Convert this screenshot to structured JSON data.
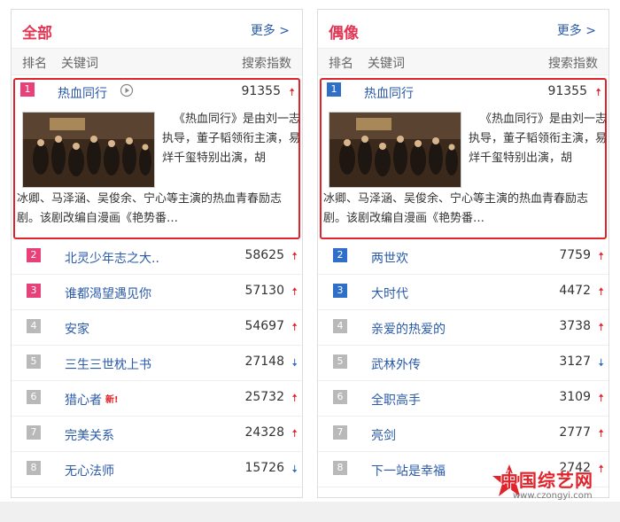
{
  "left_panel": {
    "title": "全部",
    "more": "更多 >",
    "columns": {
      "rank": "排名",
      "keyword": "关键词",
      "index": "搜索指数"
    },
    "featured": {
      "rank": "1",
      "keyword": "热血同行",
      "index": "91355",
      "trend": "up",
      "desc_right": "《热血同行》是由刘一志执导，董子韬领衔主演，易烊千玺特别出演，胡",
      "desc_bottom": "冰卿、马泽涵、吴俊余、宁心等主演的热血青春励志剧。该剧改编自漫画《艳势番…"
    },
    "rows": [
      {
        "rank": "2",
        "keyword": "北灵少年志之大..",
        "index": "58625",
        "trend": "up",
        "badge": "hot"
      },
      {
        "rank": "3",
        "keyword": "谁都渴望遇见你",
        "index": "57130",
        "trend": "up",
        "badge": "hot"
      },
      {
        "rank": "4",
        "keyword": "安家",
        "index": "54697",
        "trend": "up",
        "badge": "gray"
      },
      {
        "rank": "5",
        "keyword": "三生三世枕上书",
        "index": "27148",
        "trend": "down",
        "badge": "gray"
      },
      {
        "rank": "6",
        "keyword": "猎心者",
        "index": "25732",
        "trend": "up",
        "badge": "gray",
        "tag": "新!"
      },
      {
        "rank": "7",
        "keyword": "完美关系",
        "index": "24328",
        "trend": "up",
        "badge": "gray"
      },
      {
        "rank": "8",
        "keyword": "无心法师",
        "index": "15726",
        "trend": "down",
        "badge": "gray"
      }
    ]
  },
  "right_panel": {
    "title": "偶像",
    "more": "更多 >",
    "columns": {
      "rank": "排名",
      "keyword": "关键词",
      "index": "搜索指数"
    },
    "featured": {
      "rank": "1",
      "keyword": "热血同行",
      "index": "91355",
      "trend": "up",
      "desc_right": "《热血同行》是由刘一志执导，董子韬领衔主演，易烊千玺特别出演，胡",
      "desc_bottom": "冰卿、马泽涵、吴俊余、宁心等主演的热血青春励志剧。该剧改编自漫画《艳势番…"
    },
    "rows": [
      {
        "rank": "2",
        "keyword": "两世欢",
        "index": "7759",
        "trend": "up",
        "badge": "blue"
      },
      {
        "rank": "3",
        "keyword": "大时代",
        "index": "4472",
        "trend": "up",
        "badge": "blue"
      },
      {
        "rank": "4",
        "keyword": "亲爱的热爱的",
        "index": "3738",
        "trend": "up",
        "badge": "gray"
      },
      {
        "rank": "5",
        "keyword": "武林外传",
        "index": "3127",
        "trend": "down",
        "badge": "gray"
      },
      {
        "rank": "6",
        "keyword": "全职高手",
        "index": "3109",
        "trend": "up",
        "badge": "gray"
      },
      {
        "rank": "7",
        "keyword": "亮剑",
        "index": "2777",
        "trend": "up",
        "badge": "gray"
      },
      {
        "rank": "8",
        "keyword": "下一站是幸福",
        "index": "2742",
        "trend": "up",
        "badge": "gray"
      }
    ]
  },
  "arrows": {
    "up": "🠅",
    "down": "🠇"
  },
  "watermark": {
    "name": "中国综艺网",
    "url": "www.czongyi.com"
  },
  "colors": {
    "accent": "#e23553",
    "link": "#2a5aa8",
    "highlight_border": "#e0242b",
    "badge_hot": "#e8417a",
    "badge_blue": "#2f6fc8",
    "badge_gray": "#b9b9b9"
  }
}
